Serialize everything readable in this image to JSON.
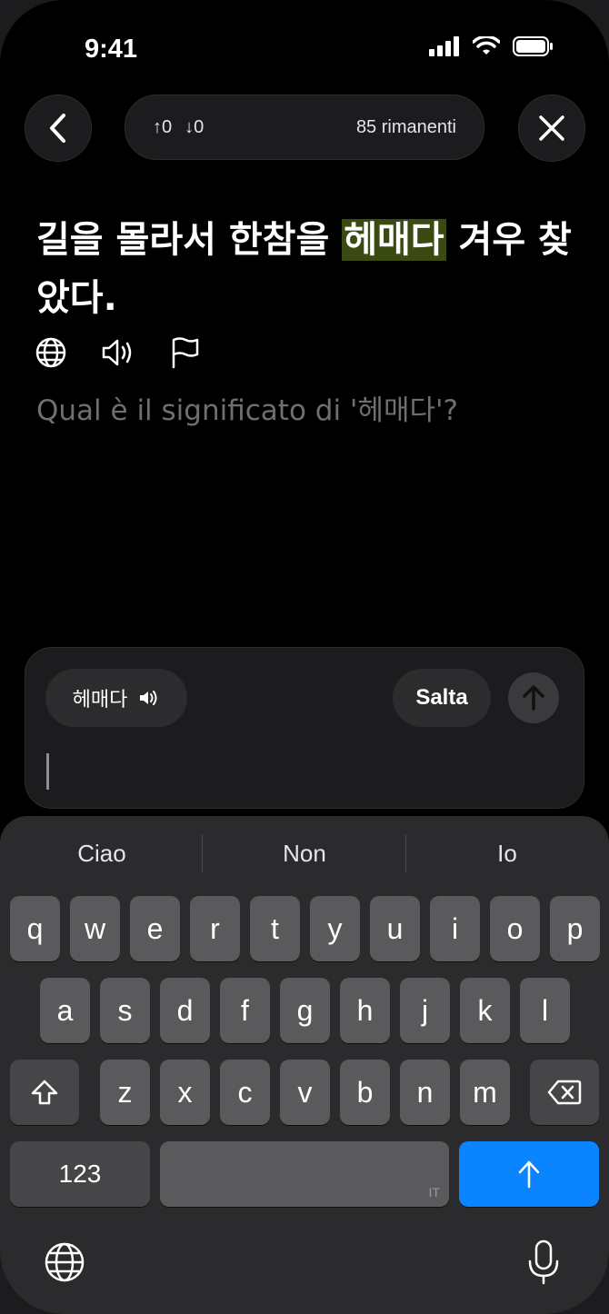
{
  "status_bar": {
    "time": "9:41"
  },
  "header": {
    "up_count": "↑0",
    "down_count": "↓0",
    "remaining": "85 rimanenti"
  },
  "sentence": {
    "before": "길을 몰라서 한참을 ",
    "highlight": "헤매다",
    "after": " 겨우 찾았다."
  },
  "question": "Qual è il significato di '헤매다'?",
  "answer_panel": {
    "word_chip": "헤매다",
    "skip_label": "Salta"
  },
  "keyboard": {
    "suggestions": [
      "Ciao",
      "Non",
      "Io"
    ],
    "row1": [
      "q",
      "w",
      "e",
      "r",
      "t",
      "y",
      "u",
      "i",
      "o",
      "p"
    ],
    "row2": [
      "a",
      "s",
      "d",
      "f",
      "g",
      "h",
      "j",
      "k",
      "l"
    ],
    "row3": [
      "z",
      "x",
      "c",
      "v",
      "b",
      "n",
      "m"
    ],
    "numbers_label": "123",
    "language_tag": "IT"
  },
  "colors": {
    "highlight": "#3a4a12",
    "accent": "#0a84ff"
  }
}
